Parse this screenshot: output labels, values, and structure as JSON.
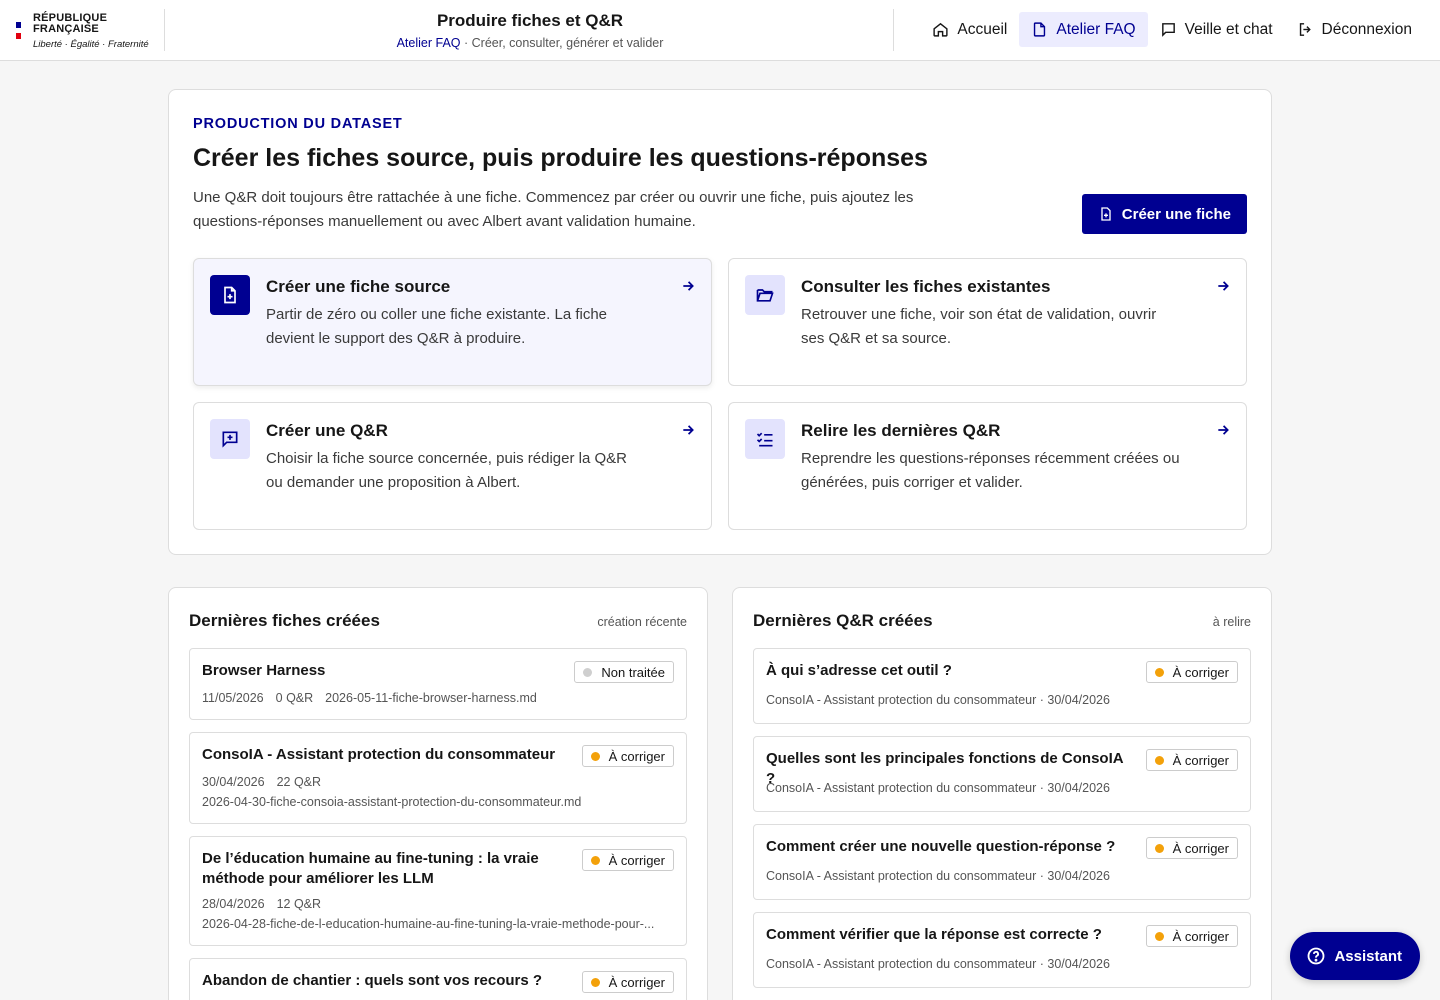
{
  "header": {
    "logo_line1": "RÉPUBLIQUE",
    "logo_line2": "FRANÇAISE",
    "motto": "Liberté · Égalité · Fraternité",
    "page_title": "Produire fiches et Q&R",
    "breadcrumb_link": "Atelier FAQ",
    "breadcrumb_sep": " · ",
    "breadcrumb_desc": "Créer, consulter, générer et valider",
    "nav": [
      {
        "label": "Accueil",
        "icon": "home-icon"
      },
      {
        "label": "Atelier FAQ",
        "icon": "document-icon",
        "active": true
      },
      {
        "label": "Veille et chat",
        "icon": "chat-icon"
      },
      {
        "label": "Déconnexion",
        "icon": "logout-icon"
      }
    ]
  },
  "hero": {
    "eyebrow": "PRODUCTION DU DATASET",
    "title": "Créer les fiches source, puis produire les questions-réponses",
    "description": "Une Q&R doit toujours être rattachée à une fiche. Commencez par créer ou ouvrir une fiche, puis ajoutez les questions-réponses manuellement ou avec Albert avant validation humaine.",
    "button_label": "Créer une fiche",
    "cards": [
      {
        "title": "Créer une fiche source",
        "desc": "Partir de zéro ou coller une fiche existante. La fiche devient le support des Q&R à produire.",
        "icon": "file-add-icon"
      },
      {
        "title": "Consulter les fiches existantes",
        "desc": "Retrouver une fiche, voir son état de validation, ouvrir ses Q&R et sa source.",
        "icon": "folder-open-icon"
      },
      {
        "title": "Créer une Q&R",
        "desc": "Choisir la fiche source concernée, puis rédiger la Q&R ou demander une proposition à Albert.",
        "icon": "chat-add-icon"
      },
      {
        "title": "Relire les dernières Q&R",
        "desc": "Reprendre les questions-réponses récemment créées ou générées, puis corriger et valider.",
        "icon": "checklist-icon"
      }
    ]
  },
  "fiches": {
    "title": "Dernières fiches créées",
    "meta": "création récente",
    "items": [
      {
        "title": "Browser Harness",
        "date": "11/05/2026",
        "count": "0 Q&R",
        "file": "2026-05-11-fiche-browser-harness.md",
        "status": "Non traitée"
      },
      {
        "title": "ConsoIA - Assistant protection du consommateur",
        "date": "30/04/2026",
        "count": "22 Q&R",
        "file": "2026-04-30-fiche-consoia-assistant-protection-du-consommateur.md",
        "status": "À corriger"
      },
      {
        "title": "De l’éducation humaine au fine-tuning : la vraie méthode pour améliorer les LLM",
        "date": "28/04/2026",
        "count": "12 Q&R",
        "file": "2026-04-28-fiche-de-l-education-humaine-au-fine-tuning-la-vraie-methode-pour-...",
        "status": "À corriger"
      },
      {
        "title": "Abandon de chantier : quels sont vos recours ?",
        "status": "À corriger"
      }
    ]
  },
  "qr": {
    "title": "Dernières Q&R créées",
    "meta": "à relire",
    "items": [
      {
        "title": "À qui s’adresse cet outil ?",
        "meta": "ConsoIA - Assistant protection du consommateur · 30/04/2026",
        "status": "À corriger"
      },
      {
        "title": "Quelles sont les principales fonctions de ConsoIA ?",
        "meta": "ConsoIA - Assistant protection du consommateur · 30/04/2026",
        "status": "À corriger"
      },
      {
        "title": "Comment créer une nouvelle question-réponse ?",
        "meta": "ConsoIA - Assistant protection du consommateur · 30/04/2026",
        "status": "À corriger"
      },
      {
        "title": "Comment vérifier que la réponse est correcte ?",
        "meta": "ConsoIA - Assistant protection du consommateur · 30/04/2026",
        "status": "À corriger"
      }
    ]
  },
  "colors": {
    "accent": "#000091",
    "warning": "#f3a10a",
    "neutral": "#cfcfcf"
  },
  "assistant_label": "Assistant"
}
